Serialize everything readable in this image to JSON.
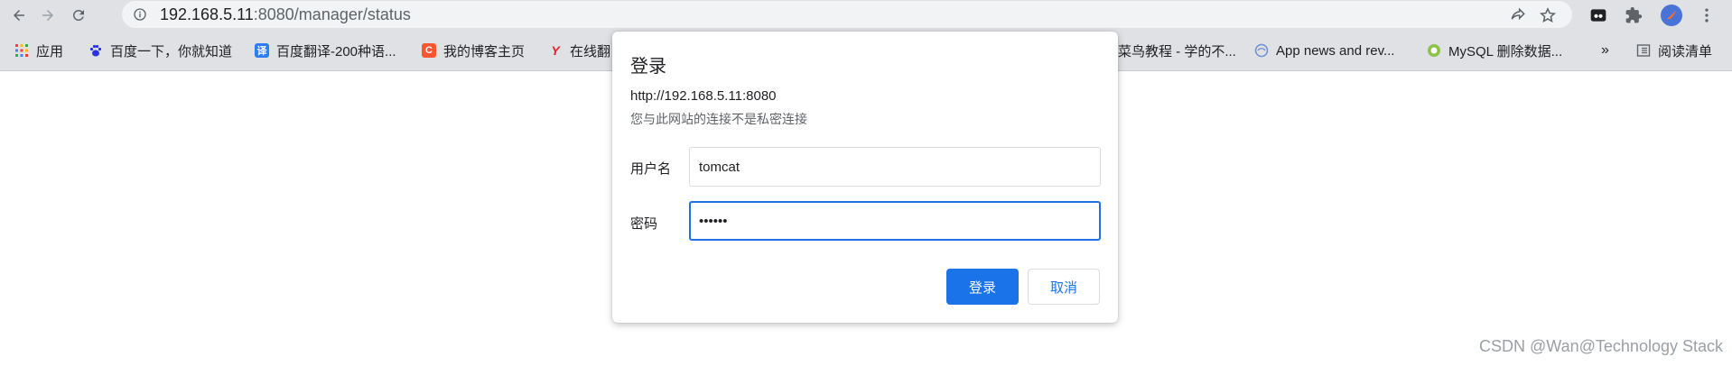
{
  "address_bar": {
    "url_host": "192.168.5.11",
    "url_rest": ":8080/manager/status"
  },
  "bookmarks": [
    {
      "label": "应用",
      "icon": "apps-grid-icon"
    },
    {
      "label": "百度一下，你就知道",
      "icon": "baidu-paw-icon"
    },
    {
      "label": "百度翻译-200种语...",
      "icon": "translate-icon",
      "glyph": "译"
    },
    {
      "label": "我的博客主页",
      "icon": "csdn-c-icon",
      "glyph": "C"
    },
    {
      "label": "在线翻",
      "icon": "youdao-y-icon",
      "glyph": "Y"
    },
    {
      "label": "菜鸟教程 - 学的不...",
      "icon": "runoob-icon"
    },
    {
      "label": "App news and rev...",
      "icon": "app-news-icon"
    },
    {
      "label": "MySQL 删除数据...",
      "icon": "mysql-icon"
    }
  ],
  "bookmarks_overflow": "»",
  "reading_list": "阅读清单",
  "dialog": {
    "title": "登录",
    "origin": "http://192.168.5.11:8080",
    "warning": "您与此网站的连接不是私密连接",
    "username_label": "用户名",
    "username_value": "tomcat",
    "password_label": "密码",
    "password_value": "••••••",
    "login_button": "登录",
    "cancel_button": "取消"
  },
  "watermark": "CSDN @Wan@Technology Stack",
  "colors": {
    "accent": "#1a73e8",
    "toolbar_bg": "#dfe1e5"
  }
}
